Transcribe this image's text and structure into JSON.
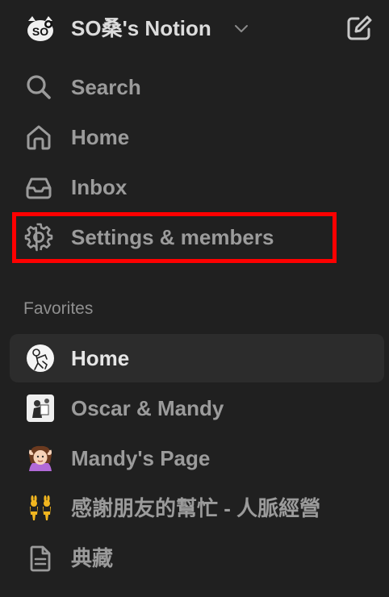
{
  "workspace": {
    "name": "SO桑's Notion",
    "logo_icon": "cat-face-icon",
    "dropdown_icon": "chevron-down-icon",
    "new_page_icon": "compose-icon"
  },
  "nav": [
    {
      "label": "Search",
      "icon": "search-icon"
    },
    {
      "label": "Home",
      "icon": "home-icon"
    },
    {
      "label": "Inbox",
      "icon": "inbox-icon"
    },
    {
      "label": "Settings & members",
      "icon": "gear-icon"
    }
  ],
  "favorites": {
    "title": "Favorites",
    "items": [
      {
        "label": "Home",
        "icon": "sketch-avatar-icon",
        "active": true
      },
      {
        "label": "Oscar & Mandy",
        "icon": "photo-thumbnail-icon",
        "active": false
      },
      {
        "label": "Mandy's Page",
        "icon": "woman-gesturing-ok-emoji",
        "active": false
      },
      {
        "label": "感謝朋友的幫忙 - 人脈經營",
        "icon": "people-with-bunny-ears-emoji",
        "active": false
      },
      {
        "label": "典藏",
        "icon": "document-icon",
        "active": false
      }
    ]
  },
  "colors": {
    "background": "#202020",
    "active_row": "#2c2c2c",
    "highlight": "#ff0000",
    "text": "#9b9b9b",
    "active_text": "#e6e6e6"
  }
}
